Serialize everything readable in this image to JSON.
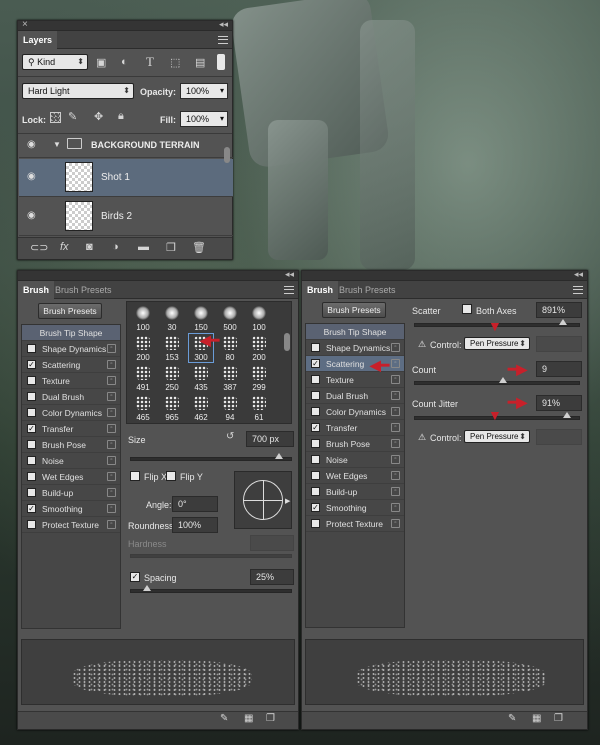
{
  "layers_panel": {
    "tab_label": "Layers",
    "filter_kind": "Kind",
    "blend_mode": "Hard Light",
    "opacity_label": "Opacity:",
    "opacity_value": "100%",
    "lock_label": "Lock:",
    "fill_label": "Fill:",
    "fill_value": "100%",
    "group_name": "BACKGROUND TERRAIN",
    "layers": [
      {
        "name": "Shot 1",
        "selected": true
      },
      {
        "name": "Birds 2",
        "selected": false
      }
    ]
  },
  "brush_left": {
    "tabs": [
      "Brush",
      "Brush Presets"
    ],
    "presets_button": "Brush Presets",
    "options": [
      {
        "label": "Brush Tip Shape",
        "checked": null
      },
      {
        "label": "Shape Dynamics",
        "checked": false
      },
      {
        "label": "Scattering",
        "checked": true
      },
      {
        "label": "Texture",
        "checked": false
      },
      {
        "label": "Dual Brush",
        "checked": false
      },
      {
        "label": "Color Dynamics",
        "checked": false
      },
      {
        "label": "Transfer",
        "checked": true
      },
      {
        "label": "Brush Pose",
        "checked": false
      },
      {
        "label": "Noise",
        "checked": false
      },
      {
        "label": "Wet Edges",
        "checked": false
      },
      {
        "label": "Build-up",
        "checked": false
      },
      {
        "label": "Smoothing",
        "checked": true
      },
      {
        "label": "Protect Texture",
        "checked": false
      }
    ],
    "tip_sizes": [
      "100",
      "30",
      "150",
      "500",
      "100",
      "200",
      "153",
      "300",
      "80",
      "200",
      "491",
      "250",
      "435",
      "387",
      "299",
      "465",
      "965",
      "462",
      "94",
      "61"
    ],
    "selected_tip": "300",
    "size_label": "Size",
    "size_value": "700 px",
    "flip_x": "Flip X",
    "flip_y": "Flip Y",
    "angle_label": "Angle:",
    "angle_value": "0°",
    "roundness_label": "Roundness:",
    "roundness_value": "100%",
    "hardness_label": "Hardness",
    "spacing_label": "Spacing",
    "spacing_value": "25%"
  },
  "brush_right": {
    "tabs": [
      "Brush",
      "Brush Presets"
    ],
    "presets_button": "Brush Presets",
    "options": [
      {
        "label": "Brush Tip Shape",
        "checked": null
      },
      {
        "label": "Shape Dynamics",
        "checked": false
      },
      {
        "label": "Scattering",
        "checked": true
      },
      {
        "label": "Texture",
        "checked": false
      },
      {
        "label": "Dual Brush",
        "checked": false
      },
      {
        "label": "Color Dynamics",
        "checked": false
      },
      {
        "label": "Transfer",
        "checked": true
      },
      {
        "label": "Brush Pose",
        "checked": false
      },
      {
        "label": "Noise",
        "checked": false
      },
      {
        "label": "Wet Edges",
        "checked": false
      },
      {
        "label": "Build-up",
        "checked": false
      },
      {
        "label": "Smoothing",
        "checked": true
      },
      {
        "label": "Protect Texture",
        "checked": false
      }
    ],
    "scatter_label": "Scatter",
    "both_axes_label": "Both Axes",
    "scatter_value": "891%",
    "control_label": "Control:",
    "control_value": "Pen Pressure",
    "count_label": "Count",
    "count_value": "9",
    "count_jitter_label": "Count Jitter",
    "count_jitter_value": "91%",
    "control2_value": "Pen Pressure"
  },
  "colors": {
    "selection": "#5c6b7d",
    "arrow": "#c8202a",
    "panel": "#535353"
  }
}
